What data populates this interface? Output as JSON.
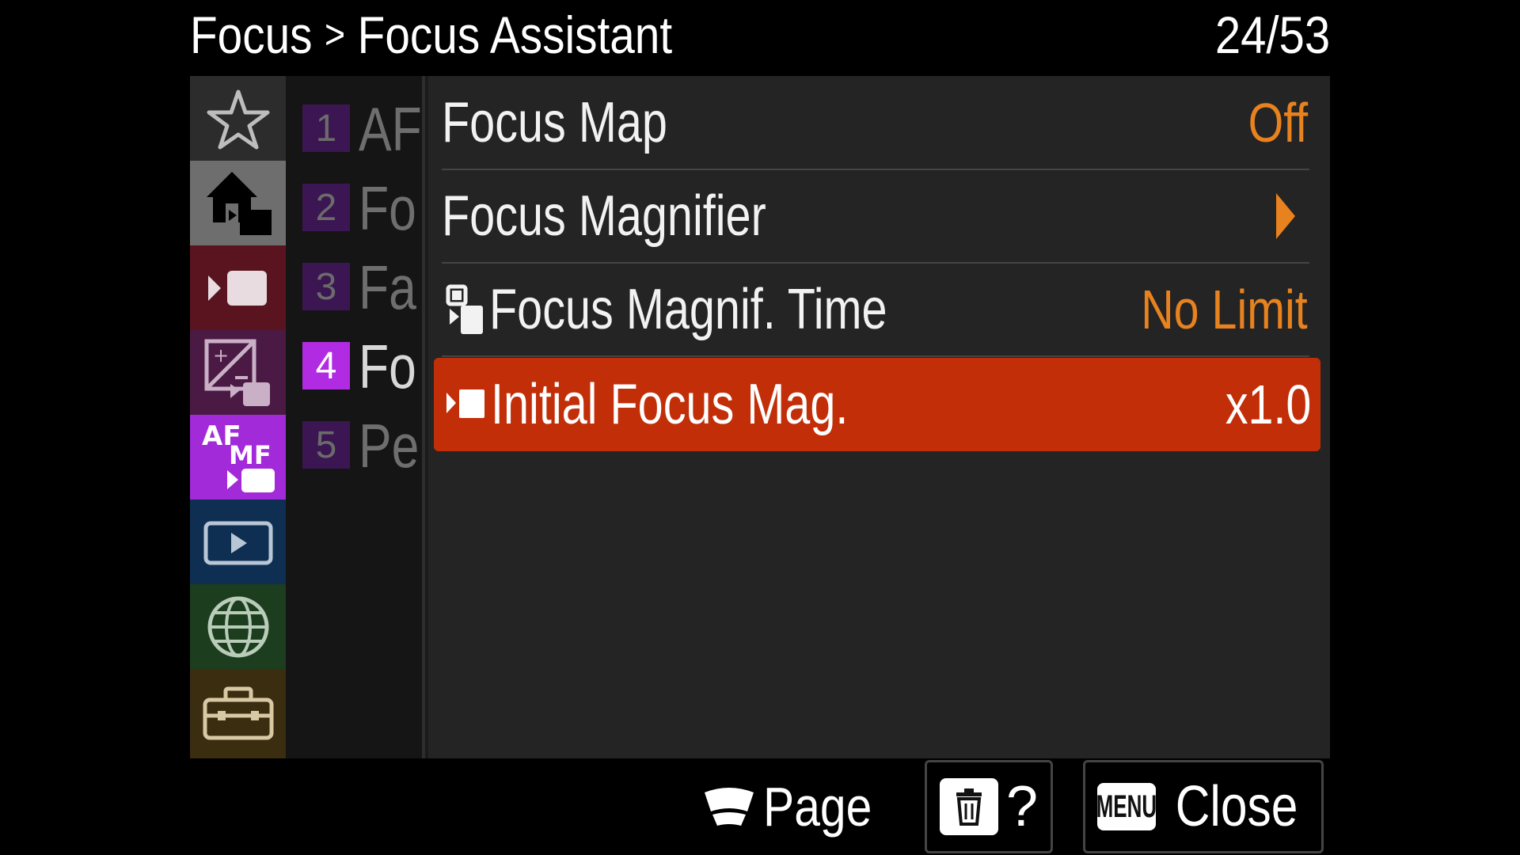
{
  "header": {
    "section": "Focus",
    "separator": ">",
    "subsection": "Focus Assistant",
    "page_counter": "24/53"
  },
  "categories": [
    {
      "icon": "star-icon",
      "color": "#2c2c2c"
    },
    {
      "icon": "home-camera-icon",
      "color": "#6e6e6e"
    },
    {
      "icon": "movie-camera-icon",
      "color": "#5a1420"
    },
    {
      "icon": "exposure-icon",
      "color": "#4a1a44"
    },
    {
      "icon": "af-mf-icon",
      "color": "#a22ad9"
    },
    {
      "icon": "playback-icon",
      "color": "#0e2f52"
    },
    {
      "icon": "globe-icon",
      "color": "#1c3d1e"
    },
    {
      "icon": "toolbox-icon",
      "color": "#3a2d10"
    }
  ],
  "pages": [
    {
      "num": "1",
      "label": "AF"
    },
    {
      "num": "2",
      "label": "Fo"
    },
    {
      "num": "3",
      "label": "Fa"
    },
    {
      "num": "4",
      "label": "Fo"
    },
    {
      "num": "5",
      "label": "Pe"
    }
  ],
  "active_page": 4,
  "menu": [
    {
      "label": "Focus Map",
      "value": "Off",
      "icon": null
    },
    {
      "label": "Focus Magnifier",
      "value": "",
      "icon": "right-arrow-icon"
    },
    {
      "label": "Focus Magnif. Time",
      "value": "No Limit",
      "icon": "still-movie-icon"
    },
    {
      "label": "Initial Focus Mag.",
      "value": "x1.0",
      "icon": "movie-icon",
      "selected": true
    }
  ],
  "footer": {
    "page_label": "Page",
    "help_key": "?",
    "menu_key": "MENU",
    "close_label": "Close"
  },
  "colors": {
    "accent_orange": "#e8821f",
    "selection_red": "#c22e08",
    "active_page_purple": "#b12be3"
  }
}
